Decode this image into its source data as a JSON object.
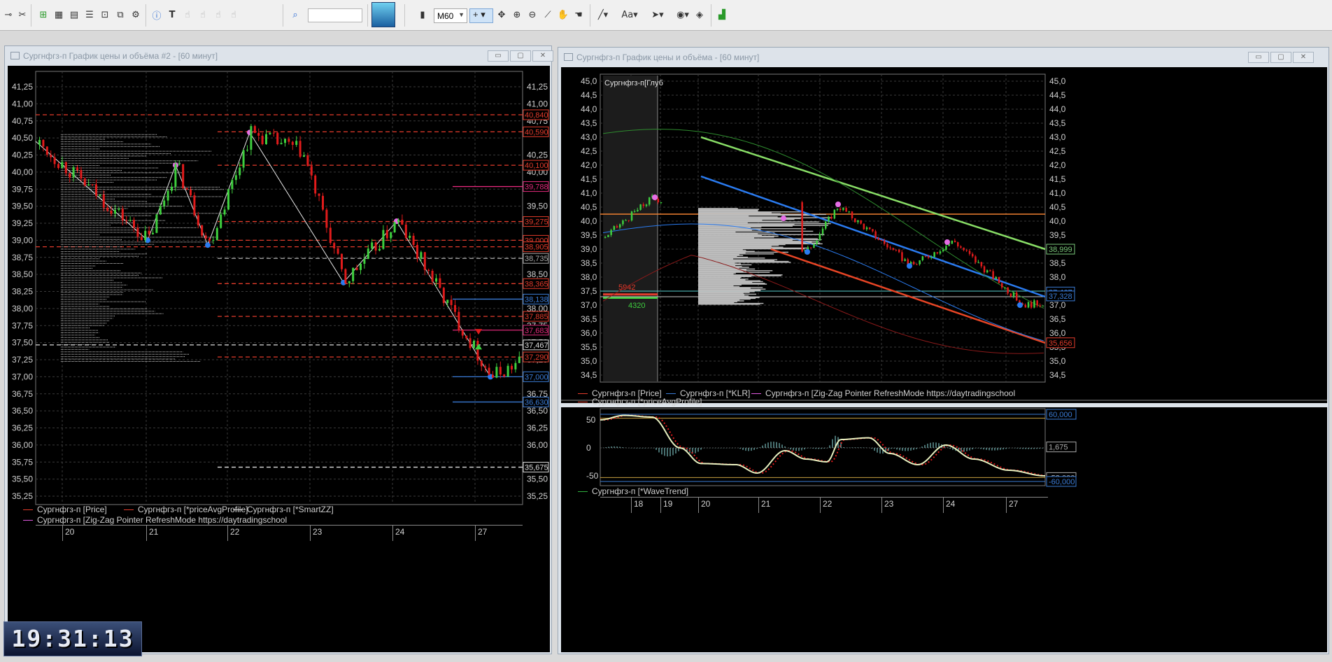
{
  "toolbar": {
    "timeframe": "M60",
    "search_placeholder": "",
    "icons": [
      "crosshair-link-icon",
      "disconnect-icon",
      "add-chart-icon",
      "chart-table-icon",
      "quotes-icon",
      "orders-icon",
      "zoom-window-icon",
      "windows-icon",
      "settings-icon",
      "info-icon",
      "text-tool-icon",
      "hand-1-icon",
      "hand-2-icon",
      "hand-3-icon",
      "hand-4-icon",
      "search-icon",
      "bar-chart-icon",
      "move-icon",
      "zoom-in-icon",
      "zoom-out-icon",
      "ruler-icon",
      "pan-icon",
      "hand-icon",
      "line-tool-icon",
      "text-size-icon",
      "arrow-tool-icon",
      "eye-icon",
      "layers-icon",
      "indicator-icon"
    ]
  },
  "clock": "19:31:13",
  "left_window": {
    "title": "Сургнфгз-п График цены и объёма #2 - [60 минут]",
    "y_ticks": [
      "41,25",
      "41,00",
      "40,75",
      "40,50",
      "40,25",
      "40,00",
      "39,75",
      "39,50",
      "39,25",
      "39,00",
      "38,75",
      "38,50",
      "38,25",
      "38,00",
      "37,75",
      "37,50",
      "37,25",
      "37,00",
      "36,75",
      "36,50",
      "36,25",
      "36,00",
      "35,75",
      "35,50",
      "35,25"
    ],
    "right_ticks": [
      "41,25",
      "41,00",
      "40,75",
      "40,25",
      "40,00",
      "39,50",
      "39,00",
      "38,50",
      "38,00",
      "37,75",
      "37,50",
      "37,25",
      "36,75",
      "36,50",
      "36,25",
      "36,00",
      "35,50",
      "35,25"
    ],
    "price_boxes": [
      {
        "label": "40,840",
        "color": "#e23b2b"
      },
      {
        "label": "40,590",
        "color": "#e23b2b"
      },
      {
        "label": "40,100",
        "color": "#e23b2b"
      },
      {
        "label": "39,788",
        "color": "#e0297a"
      },
      {
        "label": "39,275",
        "color": "#e23b2b"
      },
      {
        "label": "39,000",
        "color": "#e23b2b"
      },
      {
        "label": "38,905",
        "color": "#e23b2b"
      },
      {
        "label": "38,735",
        "color": "#aaaaaa"
      },
      {
        "label": "38,365",
        "color": "#e23b2b"
      },
      {
        "label": "38,138",
        "color": "#3a7bd5"
      },
      {
        "label": "37,885",
        "color": "#e23b2b"
      },
      {
        "label": "37,683",
        "color": "#e0297a"
      },
      {
        "label": "37,467",
        "color": "#dddddd"
      },
      {
        "label": "37,290",
        "color": "#e23b2b"
      },
      {
        "label": "37,000",
        "color": "#3a7bd5"
      },
      {
        "label": "36,630",
        "color": "#3a7bd5"
      },
      {
        "label": "35,675",
        "color": "#dddddd"
      }
    ],
    "legend": [
      {
        "label": "Сургнфгз-п [Price]",
        "color": "#e23b2b"
      },
      {
        "label": "Сургнфгз-п [*priceAvgProfile]",
        "color": "#e23b2b"
      },
      {
        "label": "Сургнфгз-п [*SmartZZ]",
        "color": "#dddddd"
      },
      {
        "label": "Сургнфгз-п [Zig-Zag Pointer RefreshMode https://daytradingschool",
        "color": "#e05ae0"
      }
    ],
    "x_labels": [
      "20",
      "21",
      "22",
      "23",
      "24",
      "27"
    ]
  },
  "right_window": {
    "title": "Сургнфгз-п График цены и объёма - [60 минут]",
    "y_ticks": [
      "45,0",
      "44,5",
      "44,0",
      "43,5",
      "43,0",
      "42,5",
      "42,0",
      "41,5",
      "41,0",
      "40,5",
      "40,0",
      "39,5",
      "39,0",
      "38,5",
      "38,0",
      "37,5",
      "37,0",
      "36,5",
      "36,0",
      "35,5",
      "35,0",
      "34,5"
    ],
    "right_ticks": [
      "45,0",
      "44,5",
      "44,0",
      "43,5",
      "43,0",
      "42,5",
      "42,0",
      "41,5",
      "41,0",
      "40,5",
      "40,0",
      "39,5",
      "38,5",
      "38,0",
      "37,5",
      "36,5",
      "36,0",
      "35,0",
      "34,5"
    ],
    "depth_label": "Сургнфгз-п[Глуб",
    "depth_ask": "5942",
    "depth_bid": "4320",
    "price_boxes": [
      {
        "label": "38,999",
        "color": "#7ac87a"
      },
      {
        "label": "37,467",
        "color": "#3a7bd5"
      },
      {
        "label": "37,328",
        "color": "#3a7bd5"
      },
      {
        "label": "35,656",
        "color": "#e23b2b"
      }
    ],
    "legend": [
      {
        "label": "Сургнфгз-п [Price]",
        "color": "#e23b2b"
      },
      {
        "label": "Сургнфгз-п [*KLR]",
        "color": "#3a7bd5"
      },
      {
        "label": "Сургнфгз-п [Zig-Zag Pointer RefreshMode https://daytradingschool",
        "color": "#e05ae0"
      },
      {
        "label": "Сургнфгз-п [*priceAvgProfile]",
        "color": "#e23b2b"
      }
    ],
    "osc_ticks": [
      "50",
      "0",
      "-50"
    ],
    "osc_boxes": [
      {
        "label": "60,000",
        "color": "#3a7bd5"
      },
      {
        "label": "1,675",
        "color": "#aaaaaa"
      },
      {
        "label": "-53,000",
        "color": "#aaaaaa"
      },
      {
        "label": "-60,000",
        "color": "#3a7bd5"
      }
    ],
    "osc_legend": {
      "label": "Сургнфгз-п [*WaveTrend]",
      "color": "#2eaf3e"
    },
    "x_labels": [
      "18",
      "19",
      "20",
      "21",
      "22",
      "23",
      "24",
      "27"
    ]
  },
  "colors": {
    "bull": "#3ecf3e",
    "bear": "#e01b1b",
    "bg": "#000000",
    "grid": "#3a3a3a"
  }
}
